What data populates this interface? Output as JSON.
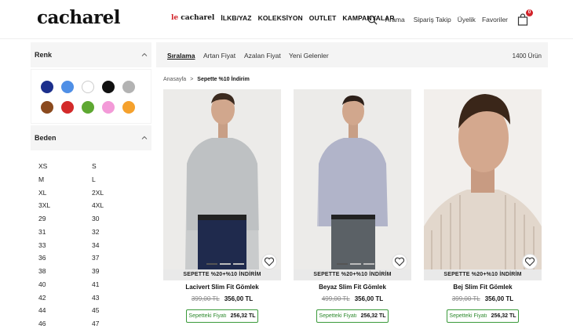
{
  "header": {
    "logo": "cacharel",
    "nav_brand_le": "le",
    "nav_brand_name": "cacharel",
    "nav": [
      "İLKB/YAZ",
      "KOLEKSİYON",
      "OUTLET",
      "KAMPANYALAR"
    ],
    "search_label": "Arama",
    "order_track": "Sipariş Takip",
    "membership": "Üyelik",
    "favorites": "Favoriler",
    "cart_count": "0"
  },
  "sidebar": {
    "color_title": "Renk",
    "colors": [
      "#1c2f8c",
      "#4f8fe6",
      "#ffffff",
      "#111111",
      "#b3b3b3",
      "#8b4a1e",
      "#d32a2a",
      "#5ea832",
      "#f39ad8",
      "#f5a12d"
    ],
    "size_title": "Beden",
    "sizes": [
      "XS",
      "S",
      "M",
      "L",
      "XL",
      "2XL",
      "3XL",
      "4XL",
      "29",
      "30",
      "31",
      "32",
      "33",
      "34",
      "36",
      "37",
      "38",
      "39",
      "40",
      "41",
      "42",
      "43",
      "44",
      "45",
      "46",
      "47"
    ]
  },
  "sortbar": {
    "items": [
      "Sıralama",
      "Artan Fiyat",
      "Azalan Fiyat",
      "Yeni Gelenler"
    ],
    "count": "1400 Ürün"
  },
  "breadcrumb": {
    "home": "Anasayfa",
    "sep": ">",
    "current": "Sepette %10 İndirim"
  },
  "products": [
    {
      "promo": "SEPETTE %20+%10 İNDİRİM",
      "name": "Lacivert Slim Fit Gömlek",
      "old_price": "399,00 TL",
      "price": "356,00 TL",
      "basket_label": "Sepetteki Fiyatı",
      "basket_price": "256,32 TL"
    },
    {
      "promo": "SEPETTE %20+%10 İNDİRİM",
      "name": "Beyaz Slim Fit Gömlek",
      "old_price": "499,00 TL",
      "price": "356,00 TL",
      "basket_label": "Sepetteki Fiyatı",
      "basket_price": "256,32 TL"
    },
    {
      "promo": "SEPETTE %20+%10 İNDİRİM",
      "name": "Bej Slim Fit Gömlek",
      "old_price": "399,00 TL",
      "price": "356,00 TL",
      "basket_label": "Sepetteki Fiyatı",
      "basket_price": "256,32 TL"
    }
  ]
}
